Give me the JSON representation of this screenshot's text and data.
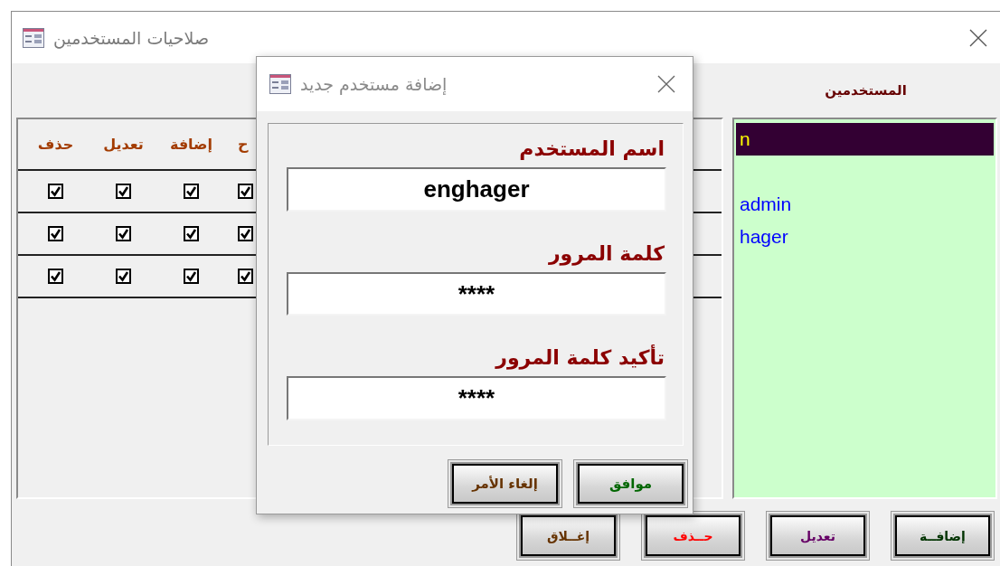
{
  "window": {
    "title": "صلاحيات المستخدمين"
  },
  "permissions": {
    "columns": [
      "ح",
      "إضافة",
      "تعديل",
      "حذف"
    ],
    "rows": [
      {
        "cells": [
          {
            "checked": true
          },
          {
            "checked": true
          },
          {
            "checked": true
          },
          {
            "checked": true
          }
        ]
      },
      {
        "cells": [
          {
            "checked": true
          },
          {
            "checked": true
          },
          {
            "checked": true
          },
          {
            "checked": true
          }
        ]
      },
      {
        "cells": [
          {
            "checked": true
          },
          {
            "checked": true
          },
          {
            "checked": true
          },
          {
            "checked": true
          }
        ]
      }
    ]
  },
  "users": {
    "title": "المستخدمين",
    "items": [
      {
        "name": "n",
        "selected": true
      },
      {
        "name": "admin",
        "selected": false
      },
      {
        "name": "hager",
        "selected": false
      }
    ]
  },
  "buttons": [
    {
      "label": "إضافــة",
      "color": "#003300"
    },
    {
      "label": "تعديل",
      "color": "#660066"
    },
    {
      "label": "حــذف",
      "color": "#ff0000"
    },
    {
      "label": "إغــلاق",
      "color": "#663300"
    }
  ],
  "dialog": {
    "title": "إضافة مستخدم جديد",
    "fields": [
      {
        "label": "اسم المستخدم",
        "value": "enghager"
      },
      {
        "label": "كلمة المرور",
        "value": "****"
      },
      {
        "label": "تأكيد كلمة المرور",
        "value": "****"
      }
    ],
    "buttons": [
      {
        "label": "موافق",
        "color": "#006600"
      },
      {
        "label": "إلغاء الأمر",
        "color": "#663300"
      }
    ]
  }
}
